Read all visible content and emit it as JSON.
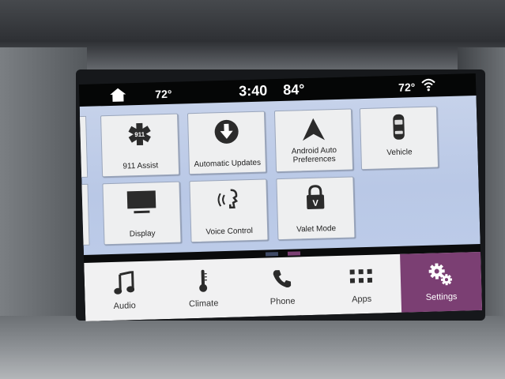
{
  "status_bar": {
    "left_temp": "72°",
    "clock": "3:40",
    "center_temp": "84°",
    "right_temp": "72°",
    "icons": [
      "home-icon",
      "wifi-icon"
    ]
  },
  "settings_tiles": [
    {
      "label": "911 Assist",
      "icon": "star-of-life-911-icon"
    },
    {
      "label": "Automatic Updates",
      "icon": "download-arrow-icon"
    },
    {
      "label": "Android Auto Preferences",
      "icon": "android-auto-icon"
    },
    {
      "label": "Vehicle",
      "icon": "car-top-view-icon"
    },
    {
      "label": "Display",
      "icon": "monitor-icon"
    },
    {
      "label": "Voice Control",
      "icon": "voice-control-icon"
    },
    {
      "label": "Valet Mode",
      "icon": "valet-lock-icon"
    }
  ],
  "pager": {
    "pages": 2,
    "current": 1,
    "colors": {
      "inactive": "#3f4a66",
      "active": "#7b3f73"
    }
  },
  "nav": {
    "items": [
      {
        "label": "Audio",
        "icon": "music-note-icon"
      },
      {
        "label": "Climate",
        "icon": "thermometer-icon"
      },
      {
        "label": "Phone",
        "icon": "phone-icon"
      },
      {
        "label": "Apps",
        "icon": "apps-grid-icon"
      },
      {
        "label": "Settings",
        "icon": "gears-icon",
        "active": true
      }
    ]
  },
  "colors": {
    "accent": "#7b3f73",
    "content_bg": "#bccbe8",
    "tile_bg": "#eeeff0",
    "status_bg": "#050606"
  }
}
